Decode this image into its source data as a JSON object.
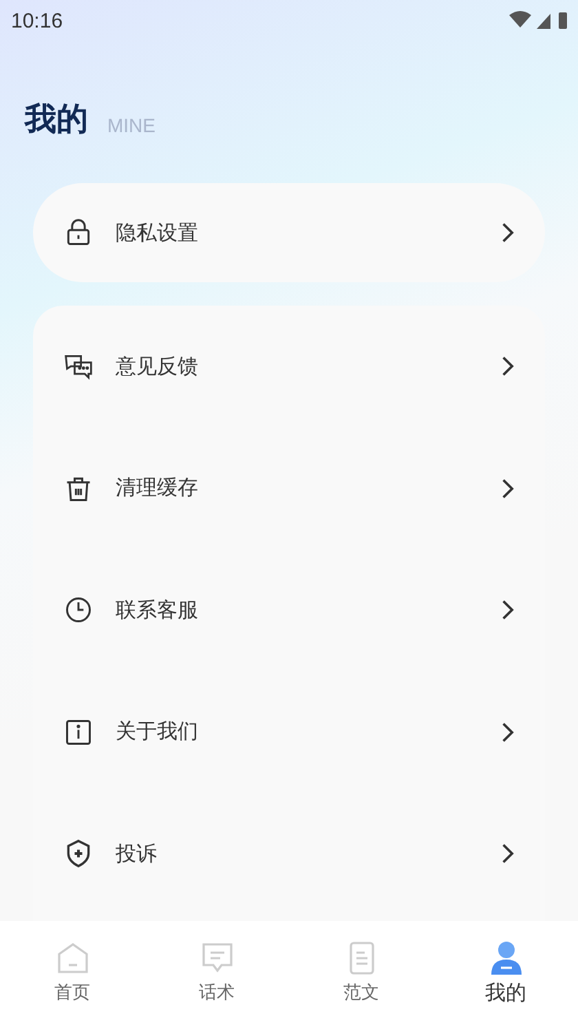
{
  "status_bar": {
    "time": "10:16"
  },
  "header": {
    "title": "我的",
    "subtitle": "MINE"
  },
  "top_item": {
    "kind": "lock",
    "label": "隐私设置"
  },
  "menu": [
    {
      "kind": "chat",
      "label": "意见反馈"
    },
    {
      "kind": "trash",
      "label": "清理缓存"
    },
    {
      "kind": "clock",
      "label": "联系客服"
    },
    {
      "kind": "info",
      "label": "关于我们"
    },
    {
      "kind": "shield",
      "label": "投诉"
    }
  ],
  "tabs": [
    {
      "kind": "home",
      "label": "首页",
      "selected": false
    },
    {
      "kind": "speech",
      "label": "话术",
      "selected": false
    },
    {
      "kind": "doc",
      "label": "范文",
      "selected": false
    },
    {
      "kind": "person",
      "label": "我的",
      "selected": true
    }
  ]
}
